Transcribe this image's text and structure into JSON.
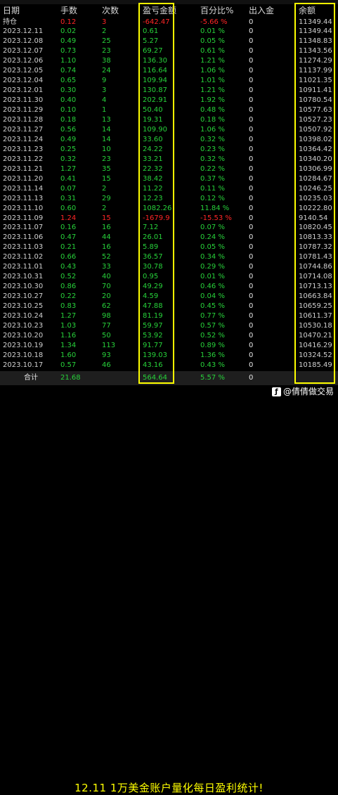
{
  "header": {
    "date": "日期",
    "lots": "手数",
    "count": "次数",
    "pnl": "盈亏金额",
    "pct": "百分比%",
    "io": "出入金",
    "balance": "余额"
  },
  "rows": [
    {
      "date": "持仓",
      "lots": "0.12",
      "count": "3",
      "pnl": "-642.47",
      "pct": "-5.66 %",
      "io": "0",
      "balance": "11349.44",
      "color": "red"
    },
    {
      "date": "2023.12.11",
      "lots": "0.02",
      "count": "2",
      "pnl": "0.61",
      "pct": "0.01 %",
      "io": "0",
      "balance": "11349.44",
      "color": "green"
    },
    {
      "date": "2023.12.08",
      "lots": "0.49",
      "count": "25",
      "pnl": "5.27",
      "pct": "0.05 %",
      "io": "0",
      "balance": "11348.83",
      "color": "green"
    },
    {
      "date": "2023.12.07",
      "lots": "0.73",
      "count": "23",
      "pnl": "69.27",
      "pct": "0.61 %",
      "io": "0",
      "balance": "11343.56",
      "color": "green"
    },
    {
      "date": "2023.12.06",
      "lots": "1.10",
      "count": "38",
      "pnl": "136.30",
      "pct": "1.21 %",
      "io": "0",
      "balance": "11274.29",
      "color": "green"
    },
    {
      "date": "2023.12.05",
      "lots": "0.74",
      "count": "24",
      "pnl": "116.64",
      "pct": "1.06 %",
      "io": "0",
      "balance": "11137.99",
      "color": "green"
    },
    {
      "date": "2023.12.04",
      "lots": "0.65",
      "count": "9",
      "pnl": "109.94",
      "pct": "1.01 %",
      "io": "0",
      "balance": "11021.35",
      "color": "green"
    },
    {
      "date": "2023.12.01",
      "lots": "0.30",
      "count": "3",
      "pnl": "130.87",
      "pct": "1.21 %",
      "io": "0",
      "balance": "10911.41",
      "color": "green"
    },
    {
      "date": "2023.11.30",
      "lots": "0.40",
      "count": "4",
      "pnl": "202.91",
      "pct": "1.92 %",
      "io": "0",
      "balance": "10780.54",
      "color": "green"
    },
    {
      "date": "2023.11.29",
      "lots": "0.10",
      "count": "1",
      "pnl": "50.40",
      "pct": "0.48 %",
      "io": "0",
      "balance": "10577.63",
      "color": "green"
    },
    {
      "date": "2023.11.28",
      "lots": "0.18",
      "count": "13",
      "pnl": "19.31",
      "pct": "0.18 %",
      "io": "0",
      "balance": "10527.23",
      "color": "green"
    },
    {
      "date": "2023.11.27",
      "lots": "0.56",
      "count": "14",
      "pnl": "109.90",
      "pct": "1.06 %",
      "io": "0",
      "balance": "10507.92",
      "color": "green"
    },
    {
      "date": "2023.11.24",
      "lots": "0.49",
      "count": "14",
      "pnl": "33.60",
      "pct": "0.32 %",
      "io": "0",
      "balance": "10398.02",
      "color": "green"
    },
    {
      "date": "2023.11.23",
      "lots": "0.25",
      "count": "10",
      "pnl": "24.22",
      "pct": "0.23 %",
      "io": "0",
      "balance": "10364.42",
      "color": "green"
    },
    {
      "date": "2023.11.22",
      "lots": "0.32",
      "count": "23",
      "pnl": "33.21",
      "pct": "0.32 %",
      "io": "0",
      "balance": "10340.20",
      "color": "green"
    },
    {
      "date": "2023.11.21",
      "lots": "1.27",
      "count": "35",
      "pnl": "22.32",
      "pct": "0.22 %",
      "io": "0",
      "balance": "10306.99",
      "color": "green"
    },
    {
      "date": "2023.11.20",
      "lots": "0.41",
      "count": "15",
      "pnl": "38.42",
      "pct": "0.37 %",
      "io": "0",
      "balance": "10284.67",
      "color": "green"
    },
    {
      "date": "2023.11.14",
      "lots": "0.07",
      "count": "2",
      "pnl": "11.22",
      "pct": "0.11 %",
      "io": "0",
      "balance": "10246.25",
      "color": "green"
    },
    {
      "date": "2023.11.13",
      "lots": "0.31",
      "count": "29",
      "pnl": "12.23",
      "pct": "0.12 %",
      "io": "0",
      "balance": "10235.03",
      "color": "green"
    },
    {
      "date": "2023.11.10",
      "lots": "0.60",
      "count": "2",
      "pnl": "1082.26",
      "pct": "11.84 %",
      "io": "0",
      "balance": "10222.80",
      "color": "green"
    },
    {
      "date": "2023.11.09",
      "lots": "1.24",
      "count": "15",
      "pnl": "-1679.9",
      "pct": "-15.53 %",
      "io": "0",
      "balance": "9140.54",
      "color": "red"
    },
    {
      "date": "2023.11.07",
      "lots": "0.16",
      "count": "16",
      "pnl": "7.12",
      "pct": "0.07 %",
      "io": "0",
      "balance": "10820.45",
      "color": "green"
    },
    {
      "date": "2023.11.06",
      "lots": "0.47",
      "count": "44",
      "pnl": "26.01",
      "pct": "0.24 %",
      "io": "0",
      "balance": "10813.33",
      "color": "green"
    },
    {
      "date": "2023.11.03",
      "lots": "0.21",
      "count": "16",
      "pnl": "5.89",
      "pct": "0.05 %",
      "io": "0",
      "balance": "10787.32",
      "color": "green"
    },
    {
      "date": "2023.11.02",
      "lots": "0.66",
      "count": "52",
      "pnl": "36.57",
      "pct": "0.34 %",
      "io": "0",
      "balance": "10781.43",
      "color": "green"
    },
    {
      "date": "2023.11.01",
      "lots": "0.43",
      "count": "33",
      "pnl": "30.78",
      "pct": "0.29 %",
      "io": "0",
      "balance": "10744.86",
      "color": "green"
    },
    {
      "date": "2023.10.31",
      "lots": "0.52",
      "count": "40",
      "pnl": "0.95",
      "pct": "0.01 %",
      "io": "0",
      "balance": "10714.08",
      "color": "green"
    },
    {
      "date": "2023.10.30",
      "lots": "0.86",
      "count": "70",
      "pnl": "49.29",
      "pct": "0.46 %",
      "io": "0",
      "balance": "10713.13",
      "color": "green"
    },
    {
      "date": "2023.10.27",
      "lots": "0.22",
      "count": "20",
      "pnl": "4.59",
      "pct": "0.04 %",
      "io": "0",
      "balance": "10663.84",
      "color": "green"
    },
    {
      "date": "2023.10.25",
      "lots": "0.83",
      "count": "62",
      "pnl": "47.88",
      "pct": "0.45 %",
      "io": "0",
      "balance": "10659.25",
      "color": "green"
    },
    {
      "date": "2023.10.24",
      "lots": "1.27",
      "count": "98",
      "pnl": "81.19",
      "pct": "0.77 %",
      "io": "0",
      "balance": "10611.37",
      "color": "green"
    },
    {
      "date": "2023.10.23",
      "lots": "1.03",
      "count": "77",
      "pnl": "59.97",
      "pct": "0.57 %",
      "io": "0",
      "balance": "10530.18",
      "color": "green"
    },
    {
      "date": "2023.10.20",
      "lots": "1.16",
      "count": "50",
      "pnl": "53.92",
      "pct": "0.52 %",
      "io": "0",
      "balance": "10470.21",
      "color": "green"
    },
    {
      "date": "2023.10.19",
      "lots": "1.34",
      "count": "113",
      "pnl": "91.77",
      "pct": "0.89 %",
      "io": "0",
      "balance": "10416.29",
      "color": "green"
    },
    {
      "date": "2023.10.18",
      "lots": "1.60",
      "count": "93",
      "pnl": "139.03",
      "pct": "1.36 %",
      "io": "0",
      "balance": "10324.52",
      "color": "green"
    },
    {
      "date": "2023.10.17",
      "lots": "0.57",
      "count": "46",
      "pnl": "43.16",
      "pct": "0.43 %",
      "io": "0",
      "balance": "10185.49",
      "color": "green"
    }
  ],
  "totals": {
    "label": "合计",
    "lots": "21.68",
    "pnl": "564.64",
    "pct": "5.57 %",
    "io": "0"
  },
  "footer": {
    "caption": "12.11 1万美金账户量化每日盈利统计!",
    "watermark": "@倩倩做交易"
  },
  "colors": {
    "highlight": "#ffff00",
    "profit": "#27d13a",
    "loss": "#ff2626",
    "background": "#000000"
  },
  "icons": {
    "watermark_logo": "social-app-icon"
  }
}
